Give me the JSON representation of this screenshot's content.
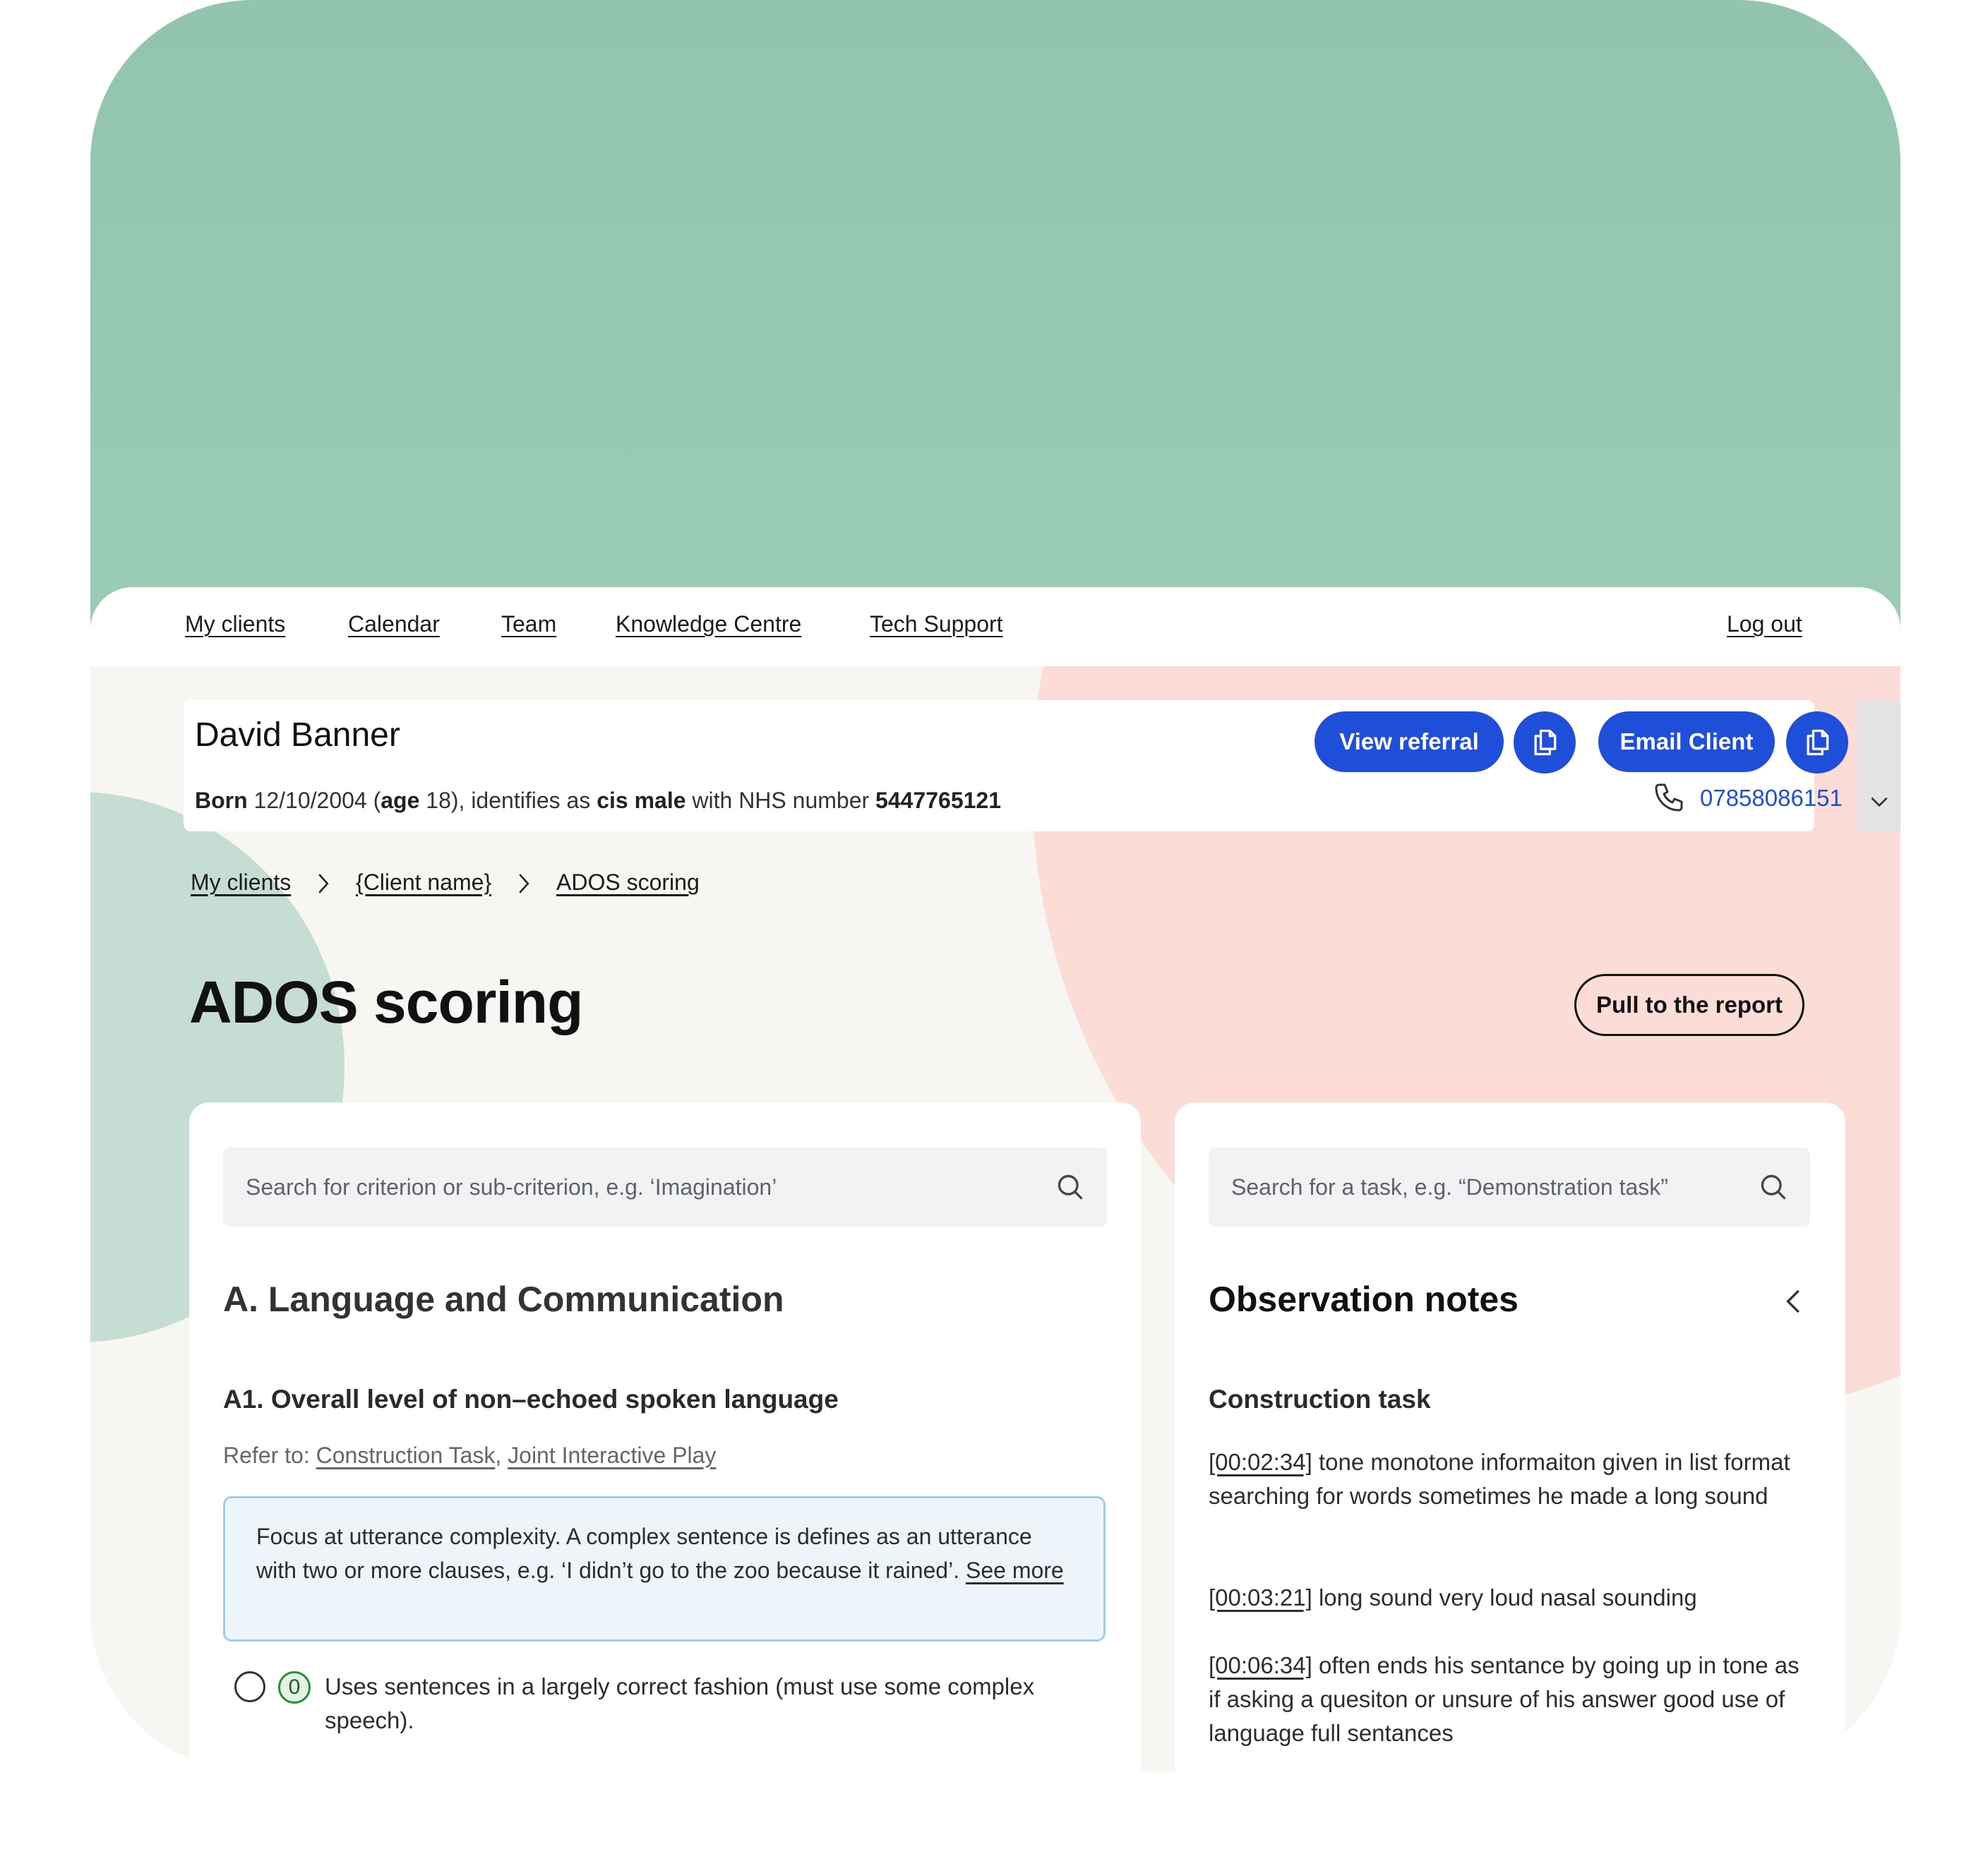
{
  "nav": {
    "items": [
      "My clients",
      "Calendar",
      "Team",
      "Knowledge Centre",
      "Tech Support"
    ],
    "logout": "Log out"
  },
  "client": {
    "name": "David Banner",
    "born_label": "Born",
    "dob": "12/10/2004",
    "age_label": "age",
    "age": "18",
    "identifies_text": "identifies as",
    "gender": "cis male",
    "nhs_text": "with NHS number",
    "nhs_number": "5447765121",
    "phone": "07858086151",
    "view_referral": "View referral",
    "email_client": "Email Client"
  },
  "breadcrumb": [
    "My clients",
    "{Client name}",
    "ADOS scoring"
  ],
  "page": {
    "title": "ADOS scoring",
    "pull_button": "Pull to the report"
  },
  "criteria_panel": {
    "search_placeholder": "Search for criterion or sub-criterion, e.g. ‘Imagination’",
    "section_title": "A. Language and Communication",
    "item_title": "A1. Overall level of non–echoed spoken language",
    "refer_label": "Refer to:",
    "refer_links": [
      "Construction Task",
      "Joint Interactive Play"
    ],
    "info_text": "Focus at utterance complexity. A complex sentence is defines as an utterance with two or more clauses, e.g. ‘I didn’t go to the zoo because it rained’.",
    "info_link": "See more",
    "options": [
      {
        "score": "0",
        "text": "Uses sentences in a largely correct fashion (must use some complex speech)."
      }
    ]
  },
  "notes_panel": {
    "search_placeholder": "Search for a task, e.g. “Demonstration task”",
    "title": "Observation notes",
    "task_title": "Construction task",
    "notes": [
      {
        "time": "[00:02:34]",
        "text": "tone monotone informaiton given in list format searching for words sometimes he made a long sound"
      },
      {
        "time": "[00:03:21]",
        "text": "long sound very loud nasal sounding"
      },
      {
        "time": "[00:06:34]",
        "text": "often ends his sentance by going up in tone as if asking a quesiton or unsure of his answer good use of language full sentances"
      }
    ]
  },
  "colors": {
    "primary": "#1f4ed8",
    "frame_green": "#9fcfb9",
    "blob_pink": "#fcdcd6",
    "blob_green": "#c5ddd3",
    "page_bg": "#f7f6f3"
  }
}
